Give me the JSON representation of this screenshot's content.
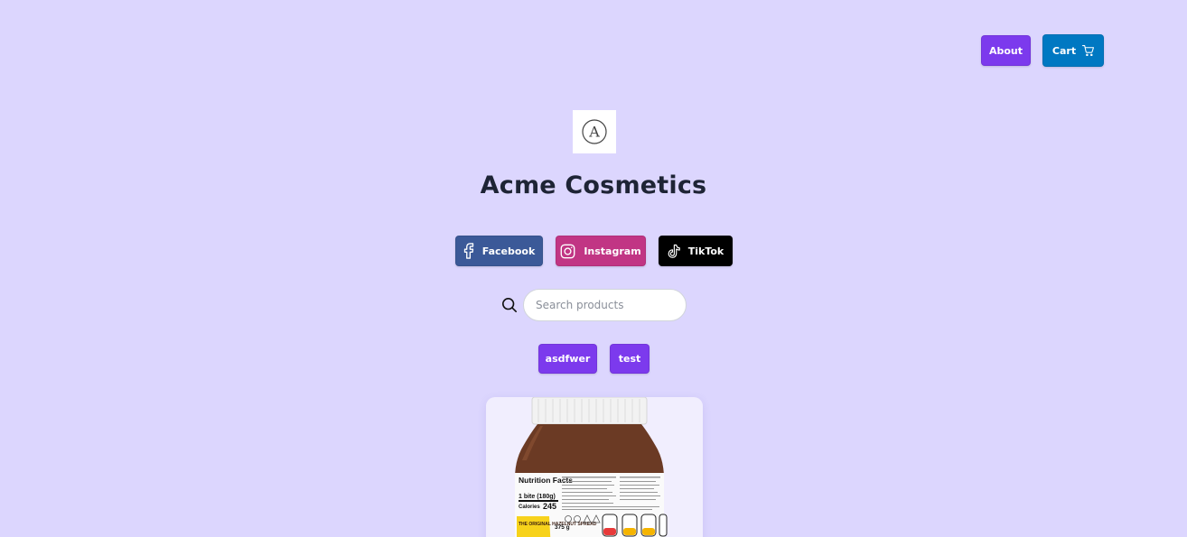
{
  "header": {
    "about_label": "About",
    "cart_label": "Cart",
    "about_color": "#7c3aed",
    "cart_color": "#0078c2"
  },
  "store": {
    "logo_letter": "A",
    "name": "Acme Cosmetics"
  },
  "social": [
    {
      "label": "Facebook",
      "icon": "facebook-icon",
      "color": "#3b5998"
    },
    {
      "label": "Instagram",
      "icon": "instagram-icon",
      "color": "#c13584"
    },
    {
      "label": "TikTok",
      "icon": "tiktok-icon",
      "color": "#000000"
    }
  ],
  "search": {
    "placeholder": "Search products",
    "value": ""
  },
  "categories": [
    {
      "label": "asdfwer"
    },
    {
      "label": "test"
    }
  ],
  "product": {
    "image_label_heading": "Nutrition Facts",
    "image_label_serving": "1 bite (180g)",
    "image_label_calories": "Calories",
    "image_label_calories_value": "245",
    "image_label_weight": "375 g",
    "image_label_badge": "THE ORIGINAL HAZELNUT SPREAD"
  },
  "colors": {
    "background": "#dcd6fe",
    "accent": "#7c3aed"
  }
}
